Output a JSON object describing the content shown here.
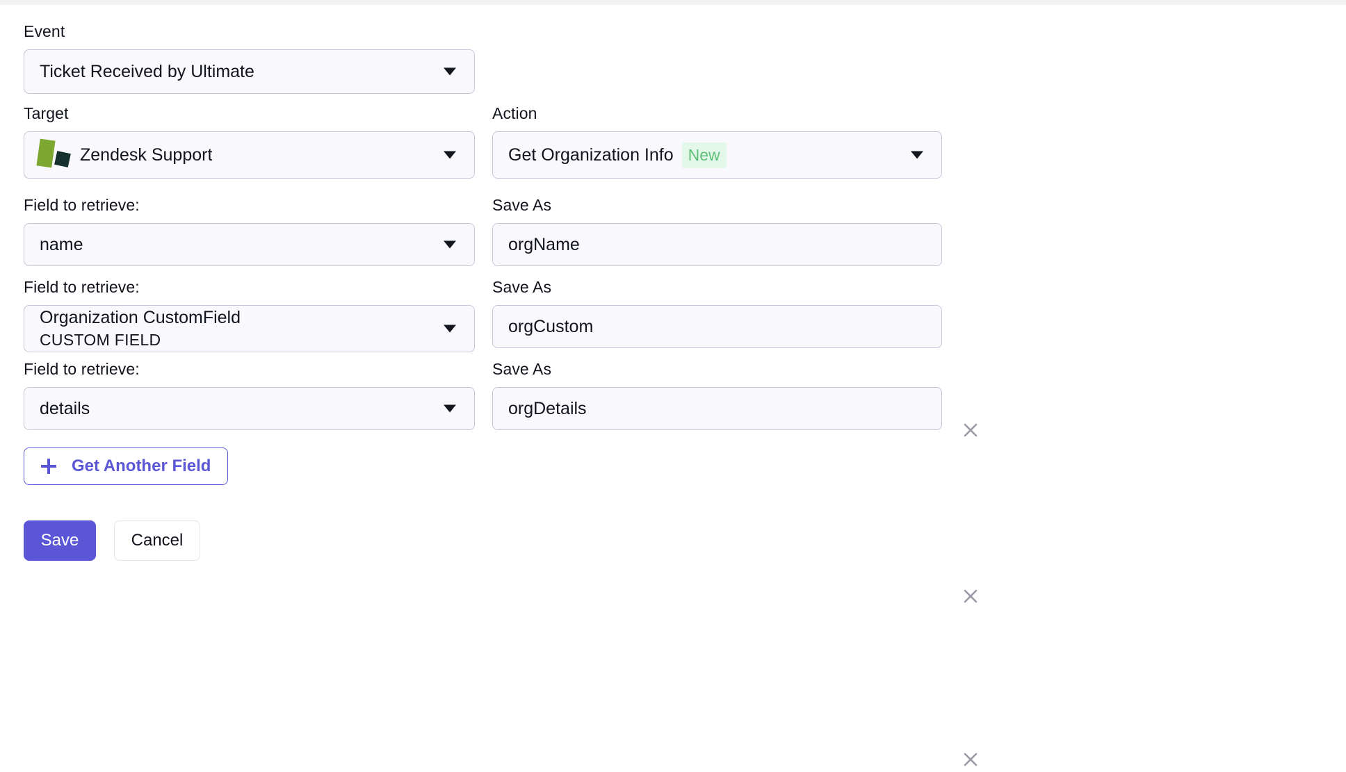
{
  "form": {
    "event": {
      "label": "Event",
      "value": "Ticket Received by Ultimate"
    },
    "target": {
      "label": "Target",
      "value": "Zendesk Support",
      "icon": "zendesk-logo-icon"
    },
    "action": {
      "label": "Action",
      "value": "Get Organization Info",
      "badge": "New",
      "badge_bg": "#e3f8e8",
      "badge_color": "#5fbf7a"
    },
    "field_rows": [
      {
        "field_label": "Field to retrieve:",
        "field_value": "name",
        "field_subvalue": "",
        "save_label": "Save As",
        "save_value": "orgName",
        "remove_icon": "close-icon"
      },
      {
        "field_label": "Field to retrieve:",
        "field_value": "Organization CustomField",
        "field_subvalue": "CUSTOM FIELD",
        "save_label": "Save As",
        "save_value": "orgCustom",
        "remove_icon": "close-icon"
      },
      {
        "field_label": "Field to retrieve:",
        "field_value": "details",
        "field_subvalue": "",
        "save_label": "Save As",
        "save_value": "orgDetails",
        "remove_icon": "close-icon"
      }
    ],
    "add_field_button": {
      "label": "Get Another Field",
      "icon": "plus-icon"
    },
    "footer": {
      "save_label": "Save",
      "cancel_label": "Cancel"
    }
  },
  "theme": {
    "accent": "#5a56d6",
    "control_bg": "#f9f9fd",
    "control_border": "#c6c6da",
    "text": "#11131d"
  }
}
